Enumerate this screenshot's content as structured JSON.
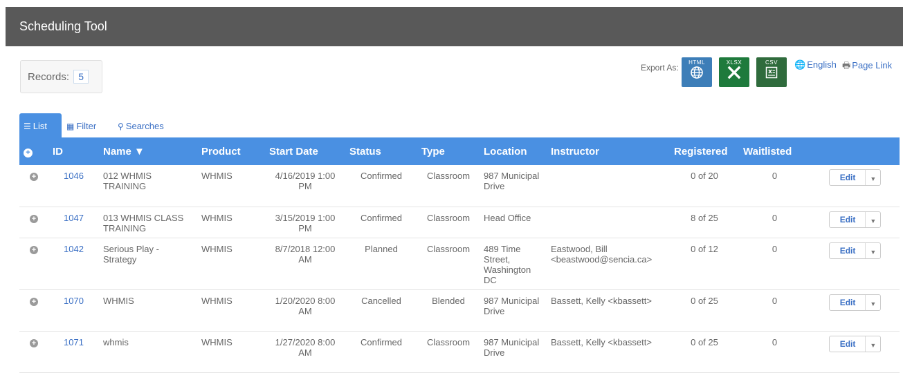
{
  "app": {
    "title": "Scheduling Tool"
  },
  "records": {
    "label": "Records:",
    "count": "5"
  },
  "export": {
    "label": "Export As:",
    "buttons": [
      {
        "tag": "HTML",
        "icon": "globe-icon"
      },
      {
        "tag": "XLSX",
        "icon": "excel-icon"
      },
      {
        "tag": "CSV",
        "icon": "csv-icon"
      }
    ]
  },
  "language": {
    "label": "English",
    "icon": "globe-icon"
  },
  "page_link": {
    "label": "Page Link",
    "icon": "printer-link-icon"
  },
  "tabs": [
    {
      "label": "List",
      "icon": "list-icon",
      "active": true
    },
    {
      "label": "Filter",
      "icon": "filter-icon"
    },
    {
      "label": "Searches",
      "icon": "search-icon"
    }
  ],
  "table": {
    "columns": {
      "id": "ID",
      "name": "Name ▼",
      "product": "Product",
      "start_date": "Start Date",
      "status": "Status",
      "type": "Type",
      "location": "Location",
      "instructor": "Instructor",
      "registered": "Registered",
      "waitlisted": "Waitlisted"
    },
    "edit_label": "Edit",
    "rows": [
      {
        "id": "1046",
        "name": "012 WHMIS TRAINING",
        "product": "WHMIS",
        "start_date": "4/16/2019 1:00 PM",
        "status": "Confirmed",
        "type": "Classroom",
        "location": "987 Municipal Drive",
        "instructor": "",
        "registered": "0 of 20",
        "waitlisted": "0"
      },
      {
        "id": "1047",
        "name": "013 WHMIS CLASS TRAINING",
        "product": "WHMIS",
        "start_date": "3/15/2019 1:00 PM",
        "status": "Confirmed",
        "type": "Classroom",
        "location": "Head Office",
        "instructor": "",
        "registered": "8 of 25",
        "waitlisted": "0"
      },
      {
        "id": "1042",
        "name": "Serious Play - Strategy",
        "product": "WHMIS",
        "start_date": "8/7/2018 12:00 AM",
        "status": "Planned",
        "type": "Classroom",
        "location": "489 Time Street, Washington DC",
        "instructor": "Eastwood, Bill <beastwood@sencia.ca>",
        "registered": "0 of 12",
        "waitlisted": "0"
      },
      {
        "id": "1070",
        "name": "WHMIS",
        "product": "WHMIS",
        "start_date": "1/20/2020 8:00 AM",
        "status": "Cancelled",
        "type": "Blended",
        "location": "987 Municipal Drive",
        "instructor": "Bassett, Kelly <kbassett>",
        "registered": "0 of 25",
        "waitlisted": "0"
      },
      {
        "id": "1071",
        "name": "whmis",
        "product": "WHMIS",
        "start_date": "1/27/2020 8:00 AM",
        "status": "Confirmed",
        "type": "Classroom",
        "location": "987 Municipal Drive",
        "instructor": "Bassett, Kelly <kbassett>",
        "registered": "0 of 25",
        "waitlisted": "0"
      }
    ]
  }
}
